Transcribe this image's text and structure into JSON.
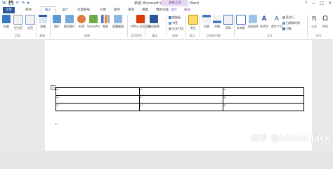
{
  "window": {
    "title": "新建 Microsoft Word 文档.docx - Word",
    "context_group": "表格工具",
    "controls": [
      "?",
      "—",
      "□",
      "✕"
    ]
  },
  "quick_access": [
    "W",
    "💾",
    "↶",
    "↷",
    "▾"
  ],
  "tabs": [
    "文件",
    "开始",
    "插入",
    "设计",
    "页面布局",
    "引用",
    "邮件",
    "审阅",
    "视图",
    "特色功能",
    "设计",
    "布局"
  ],
  "ribbon": {
    "buttons": {
      "cover": "封面",
      "blank": "空白页",
      "break": "分页",
      "table": "表格",
      "picture": "图片",
      "online_pic": "联机图片",
      "shapes": "形状",
      "smartart": "SmartArt",
      "chart": "图表",
      "screenshot": "屏幕截图",
      "office_apps": "Office 应用程序",
      "online_video": "联机视频",
      "comment": "批注",
      "header": "页眉",
      "footer": "页脚",
      "page_num": "页码",
      "textbox": "文本框",
      "quickparts": "文档部件",
      "wordart": "艺术字",
      "dropcap": "首字下沉",
      "equation": "公式",
      "symbol": "符号"
    },
    "links": [
      "超链接",
      "书签",
      "交叉引用"
    ],
    "text_small": [
      "签名行",
      "日期和时间",
      "对象"
    ],
    "groups": [
      "页面",
      "表格",
      "插图",
      "应用程序",
      "媒体",
      "链接",
      "批注",
      "页眉和页脚",
      "文本",
      "符号"
    ]
  },
  "document": {
    "table_rows": [
      [
        "↵",
        "↵",
        "↵"
      ],
      [
        "↵",
        "↵",
        "↵"
      ],
      [
        "↵",
        "↵",
        "↵"
      ]
    ],
    "paragraph_mark": "↵",
    "move_handle": "+"
  },
  "watermark": "知乎 @Ailson Jack",
  "colors": {
    "accent": "#2b579a",
    "context": "#7a3fa8"
  }
}
